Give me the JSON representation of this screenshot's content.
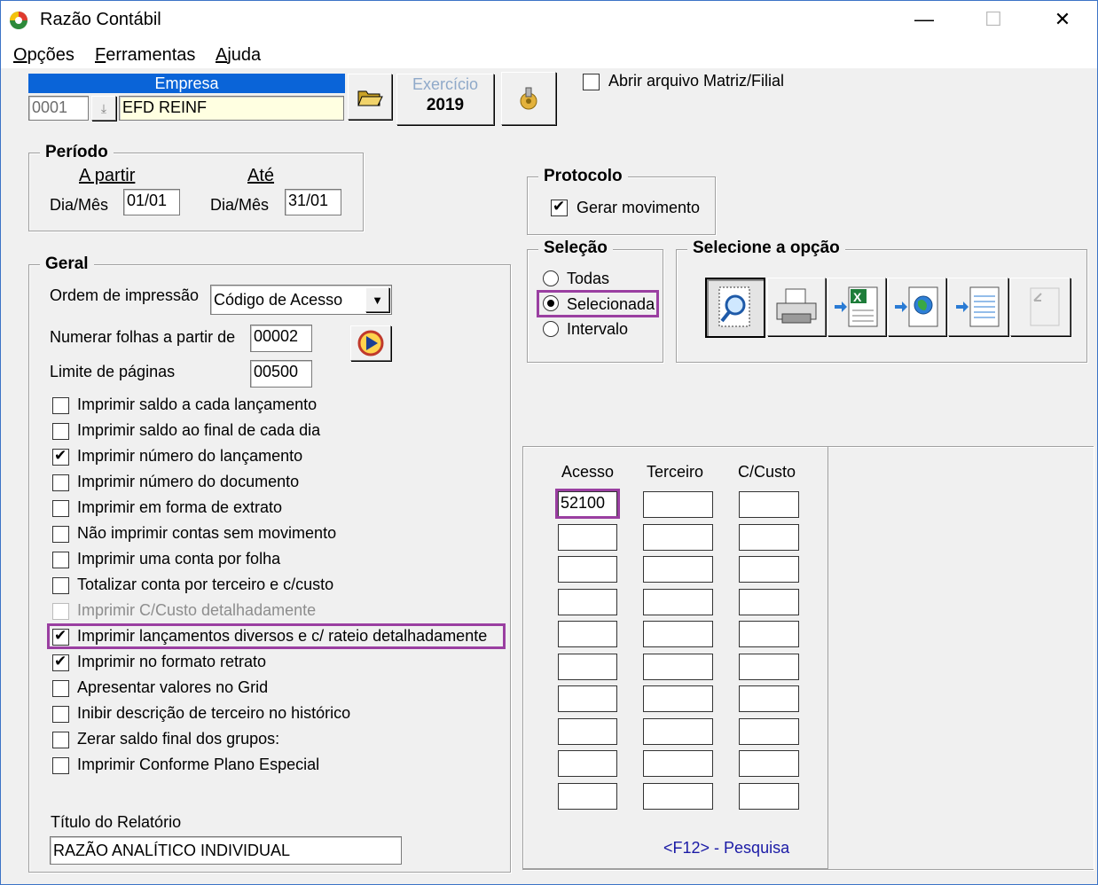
{
  "window": {
    "title": "Razão Contábil",
    "controls": {
      "minimize": "—",
      "maximize": "☐",
      "close": "✕"
    }
  },
  "menu": {
    "items": [
      {
        "label": "Opções",
        "mnemonic": "O",
        "rest": "pções"
      },
      {
        "label": "Ferramentas",
        "mnemonic": "F",
        "rest": "erramentas"
      },
      {
        "label": "Ajuda",
        "mnemonic": "A",
        "rest": "juda"
      }
    ]
  },
  "empresa": {
    "header": "Empresa",
    "code": "0001",
    "name": "EFD REINF",
    "header_color": "#0a64d8",
    "name_bg": "#ffffe1"
  },
  "exercicio": {
    "label": "Exercício",
    "value": "2019"
  },
  "abrir_matriz": {
    "label": "Abrir arquivo Matriz/Filial",
    "checked": false
  },
  "periodo": {
    "title": "Período",
    "from_header": "A partir",
    "to_header": "Até",
    "from_label": "Dia/Mês",
    "from_value": "01/01",
    "to_label": "Dia/Mês",
    "to_value": "31/01"
  },
  "protocolo": {
    "title": "Protocolo",
    "gerar_label": "Gerar movimento",
    "gerar_checked": true
  },
  "selecao": {
    "title": "Seleção",
    "options": [
      "Todas",
      "Selecionada",
      "Intervalo"
    ],
    "selected": "Selecionada"
  },
  "opcao": {
    "title": "Selecione a opção",
    "buttons": [
      "preview-icon",
      "printer-icon",
      "excel-export-icon",
      "web-export-icon",
      "text-export-icon",
      "disabled-export-icon"
    ]
  },
  "geral": {
    "title": "Geral",
    "ordem_label": "Ordem de impressão",
    "ordem_value": "Código de Acesso",
    "numerar_label": "Numerar folhas a partir de",
    "numerar_value": "00002",
    "limite_label": "Limite de páginas",
    "limite_value": "00500",
    "checkboxes": [
      {
        "label": "Imprimir saldo a cada lançamento",
        "checked": false,
        "disabled": false
      },
      {
        "label": "Imprimir saldo ao final de cada dia",
        "checked": false,
        "disabled": false
      },
      {
        "label": "Imprimir número do lançamento",
        "checked": true,
        "disabled": false
      },
      {
        "label": "Imprimir número do documento",
        "checked": false,
        "disabled": false
      },
      {
        "label": "Imprimir em forma de extrato",
        "checked": false,
        "disabled": false
      },
      {
        "label": "Não imprimir contas sem movimento",
        "checked": false,
        "disabled": false
      },
      {
        "label": "Imprimir uma conta por folha",
        "checked": false,
        "disabled": false
      },
      {
        "label": "Totalizar conta por terceiro e c/custo",
        "checked": false,
        "disabled": false
      },
      {
        "label": "Imprimir C/Custo detalhadamente",
        "checked": false,
        "disabled": true
      },
      {
        "label": "Imprimir lançamentos diversos e c/ rateio detalhadamente",
        "checked": true,
        "disabled": false
      },
      {
        "label": "Imprimir no formato retrato",
        "checked": true,
        "disabled": false
      },
      {
        "label": "Apresentar valores no Grid",
        "checked": false,
        "disabled": false
      },
      {
        "label": "Inibir descrição de terceiro no histórico",
        "checked": false,
        "disabled": false
      },
      {
        "label": "Zerar saldo final dos grupos:",
        "checked": false,
        "disabled": false
      },
      {
        "label": "Imprimir Conforme Plano Especial",
        "checked": false,
        "disabled": false
      }
    ],
    "titulo_label": "Título do Relatório",
    "titulo_value": "RAZÃO ANALÍTICO INDIVIDUAL"
  },
  "grid": {
    "columns": [
      "Acesso",
      "Terceiro",
      "C/Custo"
    ],
    "rows": [
      [
        "52100",
        "",
        ""
      ],
      [
        "",
        "",
        ""
      ],
      [
        "",
        "",
        ""
      ],
      [
        "",
        "",
        ""
      ],
      [
        "",
        "",
        ""
      ],
      [
        "",
        "",
        ""
      ],
      [
        "",
        "",
        ""
      ],
      [
        "",
        "",
        ""
      ],
      [
        "",
        "",
        ""
      ],
      [
        "",
        "",
        ""
      ]
    ],
    "hint": "<F12> - Pesquisa",
    "hint_color": "#1a1aa6"
  },
  "highlight_color": "#9a3fa1"
}
